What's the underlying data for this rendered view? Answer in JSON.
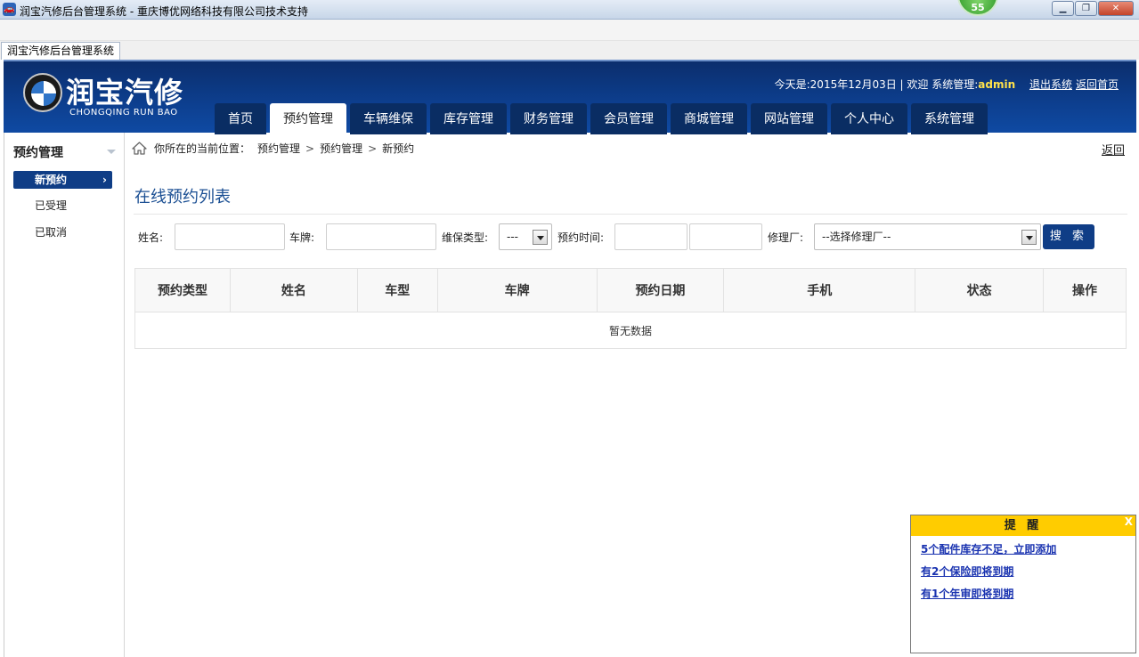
{
  "window": {
    "title": "润宝汽修后台管理系统 - 重庆博优网络科技有限公司技术支持",
    "badge": "55",
    "tab_label": "润宝汽修后台管理系统"
  },
  "header": {
    "logo_title": "润宝汽修",
    "logo_subtitle": "CHONGQING RUN BAO",
    "date_text": "今天是:2015年12月03日 | 欢迎 系统管理:",
    "user": "admin",
    "logout": "退出系统",
    "home_link": "返回首页"
  },
  "nav": [
    {
      "label": "首页",
      "active": false
    },
    {
      "label": "预约管理",
      "active": true
    },
    {
      "label": "车辆维保",
      "active": false
    },
    {
      "label": "库存管理",
      "active": false
    },
    {
      "label": "财务管理",
      "active": false
    },
    {
      "label": "会员管理",
      "active": false
    },
    {
      "label": "商城管理",
      "active": false
    },
    {
      "label": "网站管理",
      "active": false
    },
    {
      "label": "个人中心",
      "active": false
    },
    {
      "label": "系统管理",
      "active": false
    }
  ],
  "sidebar": {
    "title": "预约管理",
    "items": [
      {
        "label": "新预约",
        "active": true
      },
      {
        "label": "已受理",
        "active": false
      },
      {
        "label": "已取消",
        "active": false
      }
    ]
  },
  "breadcrumb": {
    "prefix": "你所在的当前位置：",
    "items": [
      "预约管理",
      "预约管理",
      "新预约"
    ],
    "separator": ">",
    "back": "返回"
  },
  "main": {
    "title": "在线预约列表",
    "filters": {
      "name_label": "姓名:",
      "plate_label": "车牌:",
      "type_label": "维保类型:",
      "type_value": "---",
      "time_label": "预约时间:",
      "shop_label": "修理厂:",
      "shop_value": "--选择修理厂--",
      "search_button": "搜 索"
    },
    "table": {
      "headers": [
        "预约类型",
        "姓名",
        "车型",
        "车牌",
        "预约日期",
        "手机",
        "状态",
        "操作"
      ],
      "empty_text": "暂无数据"
    }
  },
  "reminder": {
    "title": "提 醒",
    "close": "X",
    "items": [
      "5个配件库存不足，立即添加",
      "有2个保险即将到期",
      "有1个年审即将到期"
    ]
  },
  "colors": {
    "header_blue": "#0d3f8f",
    "nav_tab": "#0a2d63",
    "accent": "#0f3d86",
    "title_blue": "#1b4f93",
    "reminder_yellow": "#ffcc00",
    "admin_yellow": "#ffe24a"
  }
}
